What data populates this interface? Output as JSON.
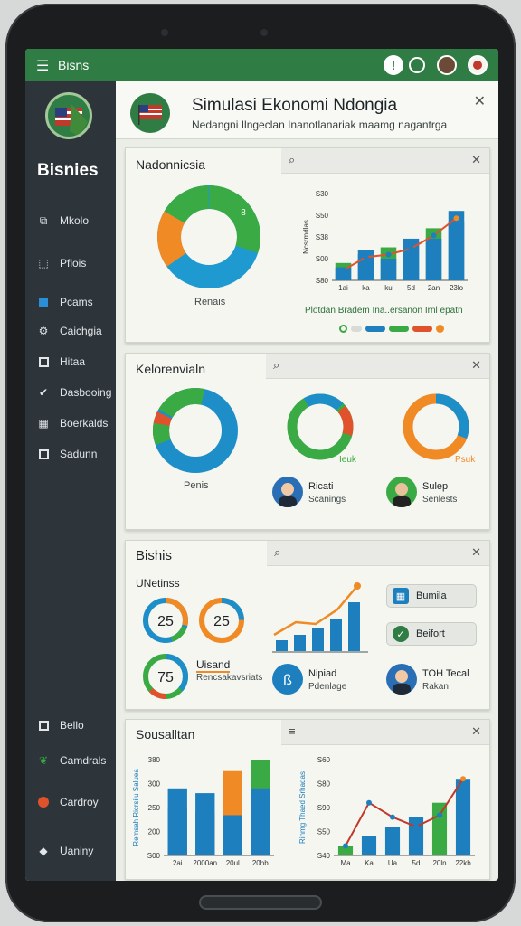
{
  "app": {
    "bar_title": "Bisns"
  },
  "header": {
    "title": "Simulasi Ekonomi Ndongia",
    "subtitle": "Nedangni Ilngeclan Inanotlanariak maamg nagantrga"
  },
  "sidebar": {
    "brand": "Bisnies",
    "items": [
      {
        "label": "Mkolo",
        "icon": "puzzle-icon"
      },
      {
        "label": "Pflois",
        "icon": "share-box-icon"
      },
      {
        "label": "Pcams",
        "icon": "square-icon"
      },
      {
        "label": "Caichgia",
        "icon": "gear-icon"
      },
      {
        "label": "Hitaa",
        "icon": "box-icon"
      },
      {
        "label": "Dasbooing",
        "icon": "check-icon"
      },
      {
        "label": "Boerkalds",
        "icon": "grid-icon"
      },
      {
        "label": "Sadunn",
        "icon": "square-icon"
      },
      {
        "label": "Bello",
        "icon": "square-icon"
      },
      {
        "label": "Camdrals",
        "icon": "leaf-icon"
      },
      {
        "label": "Cardroy",
        "icon": "circle-icon"
      },
      {
        "label": "Uaniny",
        "icon": "diamond-icon"
      }
    ]
  },
  "card1": {
    "title": "Nadonnicsia",
    "donut_label": "Renais",
    "donut_badge": "8",
    "caption": "Plotdan Bradem Ina..ersanon Irnl epatn",
    "colors": [
      "#1f7fbf",
      "#f08a25",
      "#3aaa44",
      "#1e9ad0"
    ]
  },
  "card2": {
    "title": "Kelorenvialn",
    "donut_label": "Penis",
    "ring_labels": [
      "Ieuk",
      "Psuk"
    ],
    "person1": {
      "name": "Ricati",
      "role": "Scanings"
    },
    "person2": {
      "name": "Sulep",
      "role": "Senlests"
    }
  },
  "card3": {
    "title": "Bishis",
    "subtitle": "UNetinss",
    "gauges": [
      "25",
      "25",
      "75"
    ],
    "stat_title": "Uisand",
    "stat_sub": "Rencsakavsriats",
    "buttons": [
      {
        "label": "Bumila",
        "icon": "building-icon"
      },
      {
        "label": "Beifort",
        "icon": "check-circle-icon"
      }
    ],
    "person1": {
      "name": "Nipiad",
      "role": "Pdenlage"
    },
    "person2": {
      "name": "TOH Tecal",
      "role": "Rakan"
    }
  },
  "card4": {
    "title": "Sousalltan"
  },
  "chart_data": [
    {
      "type": "bar",
      "title": "Nadonnicsia",
      "ylabel": "Ncsrmdlas",
      "categories": [
        "1ai",
        "ka",
        "ku",
        "5d",
        "2an",
        "23lo"
      ],
      "yticks": [
        "S30",
        "S50",
        "S38",
        "S00",
        "S80"
      ],
      "series": [
        {
          "values": [
            15,
            30,
            25,
            48,
            48,
            68
          ]
        },
        {
          "values": [
            20,
            35,
            38,
            45,
            60,
            80
          ]
        }
      ]
    },
    {
      "type": "bar",
      "title": "Sousalltan",
      "ylabel": "Remsah Ricrsilu Saluea",
      "categories": [
        "2ai",
        "2000an",
        "20ul",
        "20hb"
      ],
      "yticks": [
        "380",
        "300",
        "250",
        "200",
        "S00"
      ],
      "series": [
        {
          "values": [
            50,
            65,
            42,
            70
          ]
        },
        {
          "values": [
            70,
            45,
            88,
            100
          ]
        }
      ]
    },
    {
      "type": "line",
      "title": "Sousalltan",
      "ylabel": "Rinmg Thaed Srhadas",
      "categories": [
        "Ma",
        "Ka",
        "Ua",
        "5d",
        "20ln",
        "22kb"
      ],
      "yticks": [
        "S60",
        "S80",
        "S90",
        "S50",
        "S40"
      ],
      "series": [
        {
          "values": [
            10,
            20,
            30,
            40,
            55,
            80
          ]
        },
        {
          "values": [
            10,
            55,
            40,
            30,
            42,
            80
          ]
        }
      ]
    }
  ]
}
